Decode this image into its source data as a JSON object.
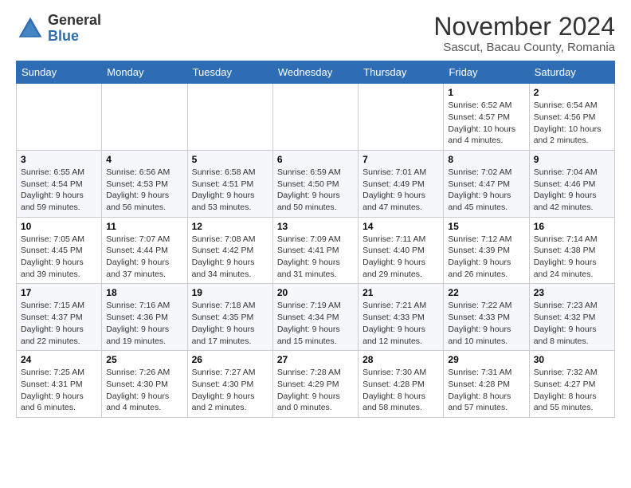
{
  "header": {
    "logo_general": "General",
    "logo_blue": "Blue",
    "month_title": "November 2024",
    "location": "Sascut, Bacau County, Romania"
  },
  "weekdays": [
    "Sunday",
    "Monday",
    "Tuesday",
    "Wednesday",
    "Thursday",
    "Friday",
    "Saturday"
  ],
  "weeks": [
    [
      {
        "day": "",
        "info": ""
      },
      {
        "day": "",
        "info": ""
      },
      {
        "day": "",
        "info": ""
      },
      {
        "day": "",
        "info": ""
      },
      {
        "day": "",
        "info": ""
      },
      {
        "day": "1",
        "info": "Sunrise: 6:52 AM\nSunset: 4:57 PM\nDaylight: 10 hours and 4 minutes."
      },
      {
        "day": "2",
        "info": "Sunrise: 6:54 AM\nSunset: 4:56 PM\nDaylight: 10 hours and 2 minutes."
      }
    ],
    [
      {
        "day": "3",
        "info": "Sunrise: 6:55 AM\nSunset: 4:54 PM\nDaylight: 9 hours and 59 minutes."
      },
      {
        "day": "4",
        "info": "Sunrise: 6:56 AM\nSunset: 4:53 PM\nDaylight: 9 hours and 56 minutes."
      },
      {
        "day": "5",
        "info": "Sunrise: 6:58 AM\nSunset: 4:51 PM\nDaylight: 9 hours and 53 minutes."
      },
      {
        "day": "6",
        "info": "Sunrise: 6:59 AM\nSunset: 4:50 PM\nDaylight: 9 hours and 50 minutes."
      },
      {
        "day": "7",
        "info": "Sunrise: 7:01 AM\nSunset: 4:49 PM\nDaylight: 9 hours and 47 minutes."
      },
      {
        "day": "8",
        "info": "Sunrise: 7:02 AM\nSunset: 4:47 PM\nDaylight: 9 hours and 45 minutes."
      },
      {
        "day": "9",
        "info": "Sunrise: 7:04 AM\nSunset: 4:46 PM\nDaylight: 9 hours and 42 minutes."
      }
    ],
    [
      {
        "day": "10",
        "info": "Sunrise: 7:05 AM\nSunset: 4:45 PM\nDaylight: 9 hours and 39 minutes."
      },
      {
        "day": "11",
        "info": "Sunrise: 7:07 AM\nSunset: 4:44 PM\nDaylight: 9 hours and 37 minutes."
      },
      {
        "day": "12",
        "info": "Sunrise: 7:08 AM\nSunset: 4:42 PM\nDaylight: 9 hours and 34 minutes."
      },
      {
        "day": "13",
        "info": "Sunrise: 7:09 AM\nSunset: 4:41 PM\nDaylight: 9 hours and 31 minutes."
      },
      {
        "day": "14",
        "info": "Sunrise: 7:11 AM\nSunset: 4:40 PM\nDaylight: 9 hours and 29 minutes."
      },
      {
        "day": "15",
        "info": "Sunrise: 7:12 AM\nSunset: 4:39 PM\nDaylight: 9 hours and 26 minutes."
      },
      {
        "day": "16",
        "info": "Sunrise: 7:14 AM\nSunset: 4:38 PM\nDaylight: 9 hours and 24 minutes."
      }
    ],
    [
      {
        "day": "17",
        "info": "Sunrise: 7:15 AM\nSunset: 4:37 PM\nDaylight: 9 hours and 22 minutes."
      },
      {
        "day": "18",
        "info": "Sunrise: 7:16 AM\nSunset: 4:36 PM\nDaylight: 9 hours and 19 minutes."
      },
      {
        "day": "19",
        "info": "Sunrise: 7:18 AM\nSunset: 4:35 PM\nDaylight: 9 hours and 17 minutes."
      },
      {
        "day": "20",
        "info": "Sunrise: 7:19 AM\nSunset: 4:34 PM\nDaylight: 9 hours and 15 minutes."
      },
      {
        "day": "21",
        "info": "Sunrise: 7:21 AM\nSunset: 4:33 PM\nDaylight: 9 hours and 12 minutes."
      },
      {
        "day": "22",
        "info": "Sunrise: 7:22 AM\nSunset: 4:33 PM\nDaylight: 9 hours and 10 minutes."
      },
      {
        "day": "23",
        "info": "Sunrise: 7:23 AM\nSunset: 4:32 PM\nDaylight: 9 hours and 8 minutes."
      }
    ],
    [
      {
        "day": "24",
        "info": "Sunrise: 7:25 AM\nSunset: 4:31 PM\nDaylight: 9 hours and 6 minutes."
      },
      {
        "day": "25",
        "info": "Sunrise: 7:26 AM\nSunset: 4:30 PM\nDaylight: 9 hours and 4 minutes."
      },
      {
        "day": "26",
        "info": "Sunrise: 7:27 AM\nSunset: 4:30 PM\nDaylight: 9 hours and 2 minutes."
      },
      {
        "day": "27",
        "info": "Sunrise: 7:28 AM\nSunset: 4:29 PM\nDaylight: 9 hours and 0 minutes."
      },
      {
        "day": "28",
        "info": "Sunrise: 7:30 AM\nSunset: 4:28 PM\nDaylight: 8 hours and 58 minutes."
      },
      {
        "day": "29",
        "info": "Sunrise: 7:31 AM\nSunset: 4:28 PM\nDaylight: 8 hours and 57 minutes."
      },
      {
        "day": "30",
        "info": "Sunrise: 7:32 AM\nSunset: 4:27 PM\nDaylight: 8 hours and 55 minutes."
      }
    ]
  ]
}
